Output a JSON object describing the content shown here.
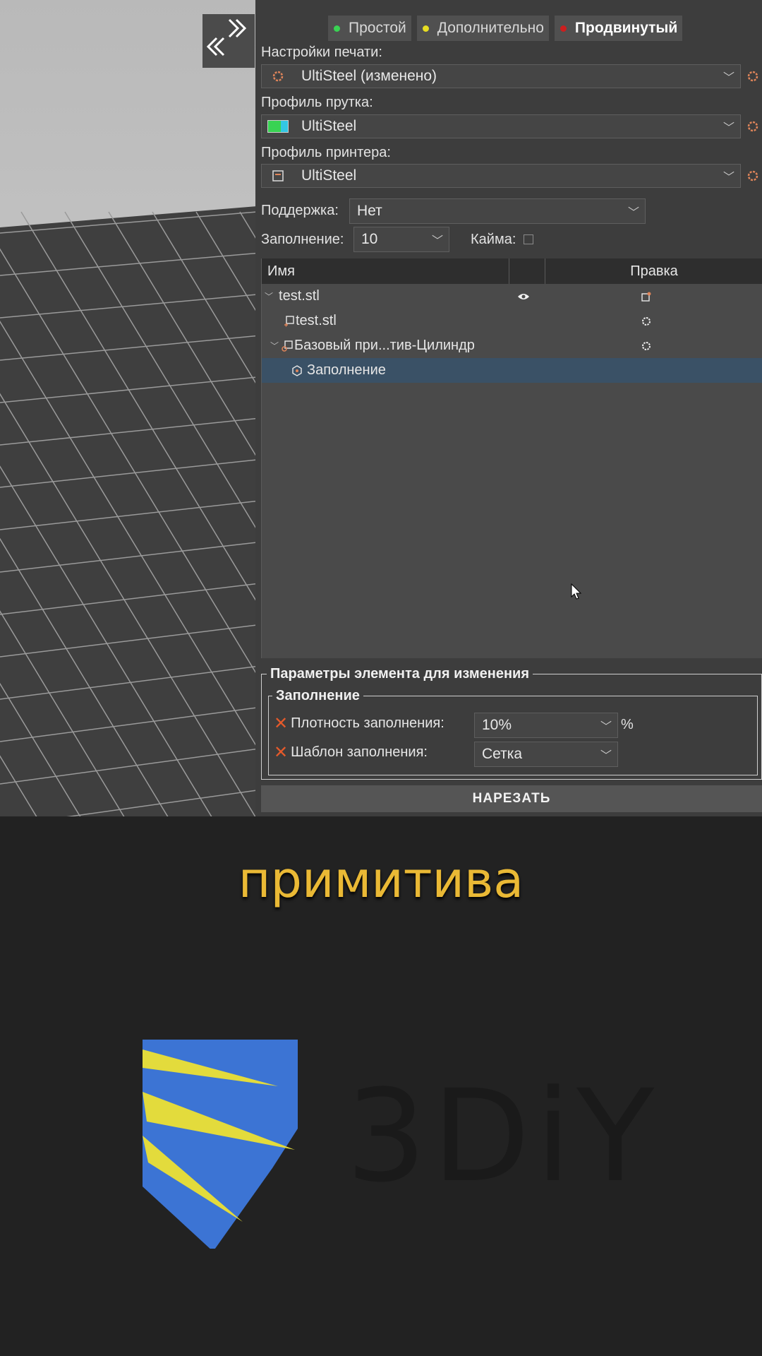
{
  "modes": [
    {
      "label": "Простой",
      "color": "#39d353"
    },
    {
      "label": "Дополнительно",
      "color": "#e7dd22"
    },
    {
      "label": "Продвинутый",
      "color": "#cc1f1f"
    }
  ],
  "print_settings": {
    "label": "Настройки печати:",
    "value": "UltiSteel (изменено)"
  },
  "filament": {
    "label": "Профиль прутка:",
    "value": "UltiSteel"
  },
  "printer": {
    "label": "Профиль принтера:",
    "value": "UltiSteel"
  },
  "support": {
    "label": "Поддержка:",
    "value": "Нет"
  },
  "infill": {
    "label": "Заполнение:",
    "value": "10"
  },
  "brim": {
    "label": "Кайма:",
    "checked": false
  },
  "tree": {
    "headers": {
      "name": "Имя",
      "edit": "Правка"
    },
    "rows": [
      {
        "name": "test.stl"
      },
      {
        "name": "test.stl"
      },
      {
        "name": "Базовый при...тив-Цилиндр"
      },
      {
        "name": "Заполнение"
      }
    ]
  },
  "params": {
    "title": "Параметры элемента для изменения",
    "group": "Заполнение",
    "density": {
      "label": "Плотность заполнения:",
      "value": "10%",
      "unit": "%"
    },
    "pattern": {
      "label": "Шаблон заполнения:",
      "value": "Сетка"
    }
  },
  "slice": "НАРЕЗАТЬ",
  "caption": "примитива",
  "logo": {
    "text": "3DiY",
    "colors": {
      "blue": "#3c74d4",
      "yellow": "#e3db3c"
    }
  }
}
